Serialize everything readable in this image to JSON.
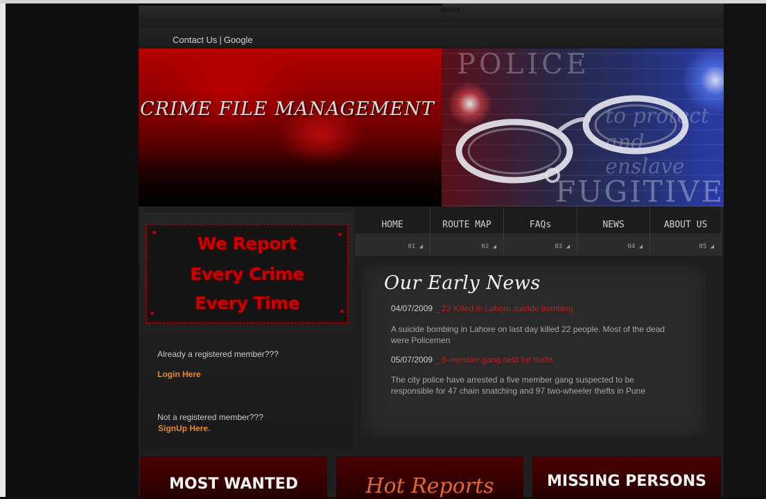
{
  "header": {
    "index_label": "index",
    "links": [
      "Contact Us",
      "Google"
    ],
    "separator": "|"
  },
  "banner": {
    "title": "CRIME FILE MANAGEMENT",
    "image_words": [
      "POLICE",
      "to protect",
      "and enslave",
      "FUGITIVE"
    ]
  },
  "sidebar": {
    "slogan": [
      "We Report",
      "Every Crime",
      "Every Time"
    ],
    "registered_question": "Already a registered member???",
    "login_link": "Login Here",
    "not_registered_question": "Not a registered member???",
    "signup_link": "SignUp Here",
    "signup_suffix": "."
  },
  "nav": {
    "items": [
      {
        "label": "HOME",
        "num": "01"
      },
      {
        "label": "ROUTE MAP",
        "num": "02"
      },
      {
        "label": "FAQs",
        "num": "03"
      },
      {
        "label": "NEWS",
        "num": "04"
      },
      {
        "label": "ABOUT US",
        "num": "05"
      }
    ]
  },
  "news": {
    "title": "Our Early News",
    "items": [
      {
        "date": "04/07/2009",
        "title": "_ 22 Killed in Lahore suicide bombing",
        "body": "A suicide bombing in Lahore on last day killed 22 people. Most of the dead were Policemen"
      },
      {
        "date": "05/07/2009",
        "title": "_ 5-member gang held for thefts",
        "body": "The city police have arrested a five member gang suspected to be responsible for 47 chain snatching and 97 two-wheeler thefts in Pune"
      }
    ]
  },
  "bottom": {
    "most_wanted": "MOST WANTED",
    "hot_reports": "Hot Reports",
    "missing_persons": "MISSING PERSONS"
  },
  "colors": {
    "accent_red": "#c41b1b",
    "link_orange": "#e8882a",
    "background": "#1f1f1f"
  }
}
